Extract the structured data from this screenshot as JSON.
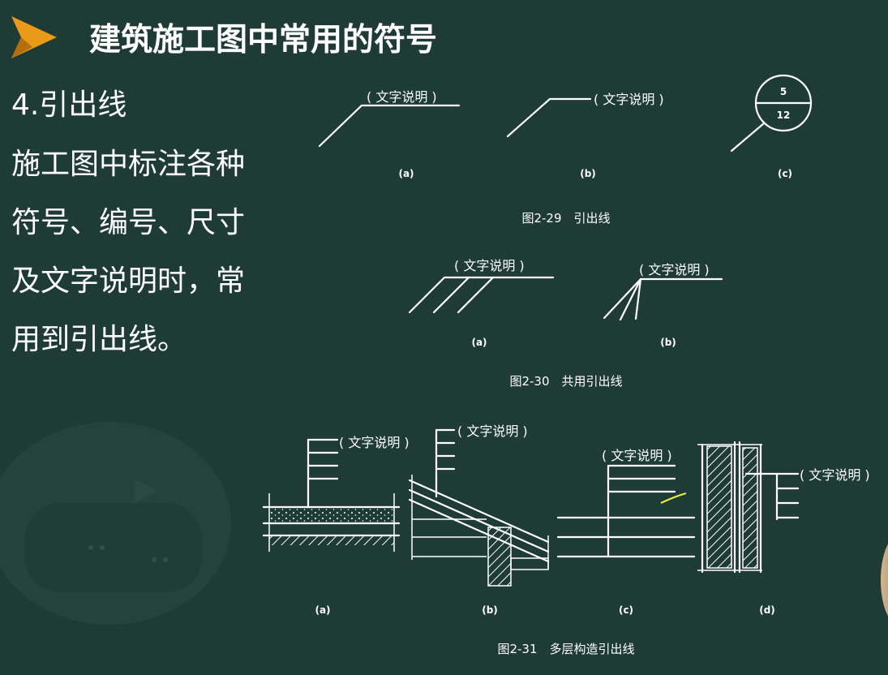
{
  "slide": {
    "title": "建筑施工图中常用的符号",
    "body_lines": [
      "4.引出线",
      "施工图中标注各种",
      "符号、编号、尺寸",
      "及文字说明时，常",
      "用到引出线。"
    ]
  },
  "colors": {
    "background": "#1f3b35",
    "accent": "#e89a18",
    "text": "#ffffff",
    "pen": "#f1ee3a"
  },
  "figures": {
    "note_label": "( 文字说明 )",
    "fig29": {
      "caption": "图2-29　引出线",
      "tags": [
        "(a)",
        "(b)",
        "(c)"
      ],
      "index_numerator": "5",
      "index_denominator": "12"
    },
    "fig30": {
      "caption": "图2-30　共用引出线",
      "tags": [
        "(a)",
        "(b)"
      ]
    },
    "fig31": {
      "caption": "图2-31　多层构造引出线",
      "tags": [
        "(a)",
        "(b)",
        "(c)",
        "(d)"
      ]
    }
  }
}
